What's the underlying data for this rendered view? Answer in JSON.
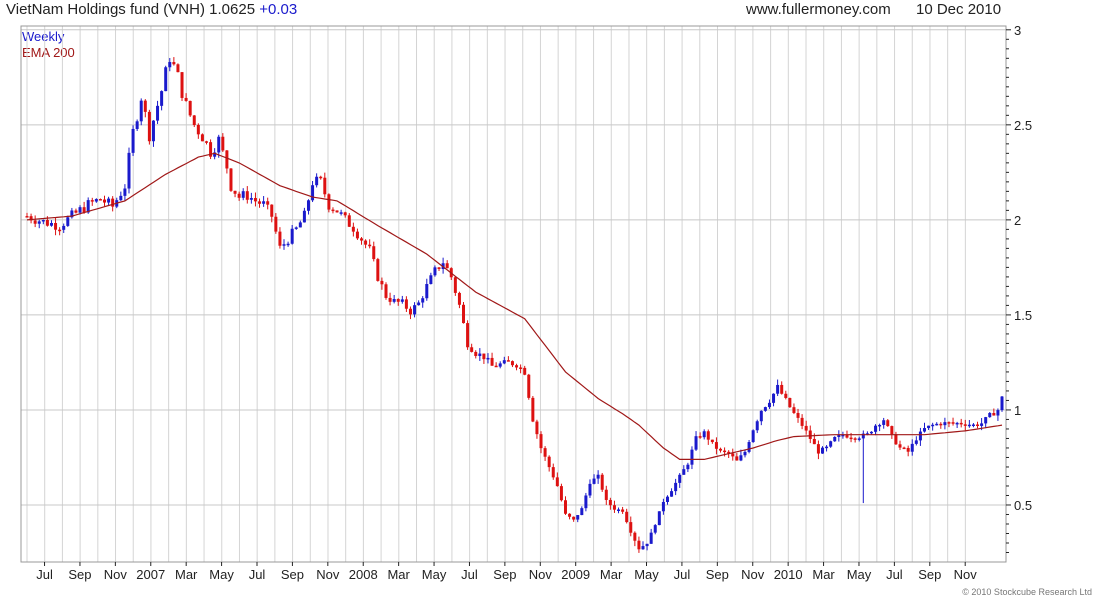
{
  "header": {
    "title": "VietNam Holdings fund (VNH)",
    "price": "1.0625",
    "change": "+0.03",
    "site": "www.fullermoney.com",
    "date": "10 Dec 2010"
  },
  "legend": {
    "series1": "Weekly",
    "series2": "EMA 200"
  },
  "copyright": "© 2010 Stockcube Research Ltd",
  "colors": {
    "up": "#1a1acc",
    "down": "#dd1111",
    "ema": "#a01818",
    "grid": "#d4d4d4",
    "axis": "#222222"
  },
  "chart_data": {
    "type": "candlestick",
    "x_tick_labels": [
      "Jul",
      "Sep",
      "Nov",
      "2007",
      "Mar",
      "May",
      "Jul",
      "Sep",
      "Nov",
      "2008",
      "Mar",
      "May",
      "Jul",
      "Sep",
      "Nov",
      "2009",
      "Mar",
      "May",
      "Jul",
      "Sep",
      "Nov",
      "2010",
      "Mar",
      "May",
      "Jul",
      "Sep",
      "Nov"
    ],
    "y_ticks": [
      0.5,
      1,
      1.5,
      2,
      2.5,
      3
    ],
    "y_tick_labels": [
      "0.5",
      "1",
      "1.5",
      "2",
      "2.5",
      "3"
    ],
    "ylim": [
      0.2,
      3.02
    ],
    "y_axis_side": "right",
    "grid": true,
    "price_anchors": [
      [
        0,
        2.02
      ],
      [
        4,
        1.99
      ],
      [
        8,
        1.97
      ],
      [
        11,
        2.02
      ],
      [
        15,
        2.08
      ],
      [
        18,
        2.11
      ],
      [
        21,
        2.07
      ],
      [
        24,
        2.18
      ],
      [
        26,
        2.46
      ],
      [
        28,
        2.65
      ],
      [
        30,
        2.45
      ],
      [
        33,
        2.68
      ],
      [
        35,
        2.86
      ],
      [
        37,
        2.75
      ],
      [
        39,
        2.6
      ],
      [
        41,
        2.5
      ],
      [
        43,
        2.44
      ],
      [
        45,
        2.36
      ],
      [
        47,
        2.42
      ],
      [
        49,
        2.28
      ],
      [
        50,
        2.18
      ],
      [
        52,
        2.12
      ],
      [
        54,
        2.13
      ],
      [
        56,
        2.1
      ],
      [
        58,
        2.08
      ],
      [
        60,
        2.02
      ],
      [
        62,
        1.85
      ],
      [
        64,
        1.9
      ],
      [
        66,
        1.95
      ],
      [
        68,
        2.02
      ],
      [
        70,
        2.2
      ],
      [
        72,
        2.2
      ],
      [
        74,
        2.08
      ],
      [
        76,
        2.05
      ],
      [
        78,
        2.0
      ],
      [
        80,
        1.96
      ],
      [
        82,
        1.9
      ],
      [
        84,
        1.84
      ],
      [
        86,
        1.7
      ],
      [
        88,
        1.6
      ],
      [
        90,
        1.57
      ],
      [
        92,
        1.56
      ],
      [
        94,
        1.52
      ],
      [
        96,
        1.56
      ],
      [
        98,
        1.65
      ],
      [
        100,
        1.73
      ],
      [
        102,
        1.78
      ],
      [
        104,
        1.7
      ],
      [
        106,
        1.55
      ],
      [
        108,
        1.35
      ],
      [
        110,
        1.3
      ],
      [
        112,
        1.28
      ],
      [
        114,
        1.23
      ],
      [
        116,
        1.24
      ],
      [
        118,
        1.25
      ],
      [
        120,
        1.24
      ],
      [
        122,
        1.2
      ],
      [
        124,
        0.95
      ],
      [
        126,
        0.8
      ],
      [
        128,
        0.7
      ],
      [
        130,
        0.6
      ],
      [
        132,
        0.45
      ],
      [
        134,
        0.42
      ],
      [
        136,
        0.48
      ],
      [
        138,
        0.62
      ],
      [
        140,
        0.65
      ],
      [
        142,
        0.52
      ],
      [
        144,
        0.48
      ],
      [
        146,
        0.47
      ],
      [
        148,
        0.36
      ],
      [
        150,
        0.27
      ],
      [
        152,
        0.3
      ],
      [
        154,
        0.4
      ],
      [
        156,
        0.52
      ],
      [
        158,
        0.58
      ],
      [
        160,
        0.65
      ],
      [
        162,
        0.72
      ],
      [
        164,
        0.85
      ],
      [
        166,
        0.88
      ],
      [
        168,
        0.82
      ],
      [
        170,
        0.78
      ],
      [
        172,
        0.77
      ],
      [
        174,
        0.73
      ],
      [
        176,
        0.78
      ],
      [
        178,
        0.9
      ],
      [
        180,
        1.0
      ],
      [
        182,
        1.05
      ],
      [
        184,
        1.12
      ],
      [
        186,
        1.05
      ],
      [
        188,
        0.98
      ],
      [
        190,
        0.92
      ],
      [
        192,
        0.85
      ],
      [
        194,
        0.78
      ],
      [
        196,
        0.8
      ],
      [
        198,
        0.85
      ],
      [
        200,
        0.87
      ],
      [
        202,
        0.86
      ],
      [
        204,
        0.86
      ],
      [
        206,
        0.87
      ],
      [
        208,
        0.92
      ],
      [
        210,
        0.95
      ],
      [
        212,
        0.86
      ],
      [
        214,
        0.8
      ],
      [
        216,
        0.78
      ],
      [
        218,
        0.85
      ],
      [
        220,
        0.9
      ],
      [
        222,
        0.92
      ],
      [
        224,
        0.93
      ],
      [
        226,
        0.93
      ],
      [
        228,
        0.93
      ],
      [
        230,
        0.93
      ],
      [
        232,
        0.92
      ],
      [
        234,
        0.93
      ],
      [
        236,
        0.97
      ],
      [
        238,
        1.0
      ],
      [
        239,
        1.0625
      ]
    ],
    "ema_anchors": [
      [
        0,
        2.0
      ],
      [
        11,
        2.02
      ],
      [
        24,
        2.1
      ],
      [
        34,
        2.24
      ],
      [
        42,
        2.33
      ],
      [
        46,
        2.35
      ],
      [
        52,
        2.3
      ],
      [
        62,
        2.18
      ],
      [
        70,
        2.12
      ],
      [
        76,
        2.1
      ],
      [
        86,
        1.97
      ],
      [
        98,
        1.82
      ],
      [
        110,
        1.62
      ],
      [
        122,
        1.48
      ],
      [
        132,
        1.2
      ],
      [
        140,
        1.06
      ],
      [
        146,
        0.98
      ],
      [
        150,
        0.92
      ],
      [
        156,
        0.8
      ],
      [
        160,
        0.74
      ],
      [
        166,
        0.74
      ],
      [
        172,
        0.77
      ],
      [
        178,
        0.8
      ],
      [
        184,
        0.84
      ],
      [
        188,
        0.86
      ],
      [
        198,
        0.87
      ],
      [
        210,
        0.87
      ],
      [
        220,
        0.87
      ],
      [
        230,
        0.89
      ],
      [
        239,
        0.92
      ]
    ],
    "outlier_wick": {
      "week": 205,
      "low": 0.51
    }
  }
}
